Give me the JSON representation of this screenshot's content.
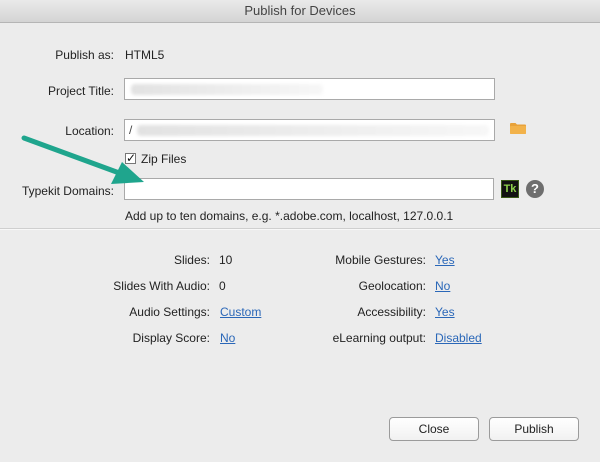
{
  "window": {
    "title": "Publish for Devices"
  },
  "form": {
    "publish_as_label": "Publish as:",
    "publish_as_value": "HTML5",
    "project_title_label": "Project Title:",
    "project_title_value": "",
    "location_label": "Location:",
    "location_value": "/",
    "zip_files_label": "Zip Files",
    "zip_files_checked": true,
    "typekit_label": "Typekit Domains:",
    "typekit_value": "",
    "typekit_hint": "Add up to ten domains, e.g. *.adobe.com, localhost, 127.0.0.1",
    "typekit_icon_text": "Tk",
    "help_icon_text": "?"
  },
  "stats": {
    "slides_label": "Slides:",
    "slides_value": "10",
    "slides_audio_label": "Slides With Audio:",
    "slides_audio_value": "0",
    "audio_settings_label": "Audio Settings:",
    "audio_settings_value": "Custom",
    "display_score_label": "Display Score:",
    "display_score_value": "No",
    "mobile_gestures_label": "Mobile Gestures:",
    "mobile_gestures_value": "Yes",
    "geolocation_label": "Geolocation:",
    "geolocation_value": "No",
    "accessibility_label": "Accessibility:",
    "accessibility_value": "Yes",
    "elearning_label": "eLearning output:",
    "elearning_value": "Disabled"
  },
  "buttons": {
    "close": "Close",
    "publish": "Publish"
  },
  "colors": {
    "link": "#2a67b8",
    "arrow": "#1fa58d",
    "folder": "#e8a23a"
  }
}
